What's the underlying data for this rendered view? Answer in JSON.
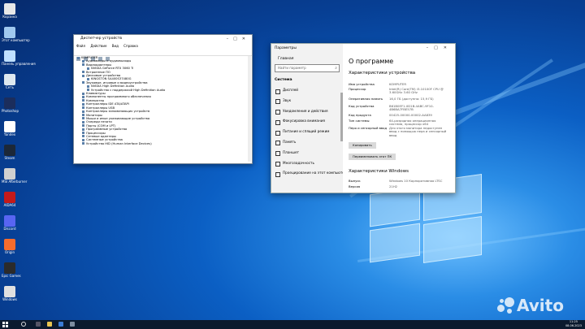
{
  "desktop_icons": [
    {
      "label": "Корзина",
      "color": "#e8e8e8"
    },
    {
      "label": "Этот компьютер",
      "color": "#9fc8ef"
    },
    {
      "label": "Панель управления",
      "color": "#bfe0ff"
    },
    {
      "label": "Сеть",
      "color": "#dde8f0"
    },
    {
      "label": "Photoshop",
      "color": "#1b2d5c"
    },
    {
      "label": "Yandex",
      "color": "#ffffff"
    },
    {
      "label": "Steam",
      "color": "#1c2838"
    },
    {
      "label": "MSI Afterburner",
      "color": "#d0d0d0"
    },
    {
      "label": "AIDA64",
      "color": "#c41a1a"
    },
    {
      "label": "Discord",
      "color": "#5865f2"
    },
    {
      "label": "Origin",
      "color": "#f56c2d"
    },
    {
      "label": "Epic Games",
      "color": "#2b2b2b"
    },
    {
      "label": "Windows",
      "color": "#e0e0e0"
    }
  ],
  "device_manager": {
    "title": "Диспетчер устройств",
    "menu": [
      "Файл",
      "Действие",
      "Вид",
      "Справка"
    ],
    "tree": [
      {
        "label": "KOMPUTER",
        "level": 0
      },
      {
        "label": "Аудиовходы и аудиовыходы",
        "level": 1
      },
      {
        "label": "Видеоадаптеры",
        "level": 1
      },
      {
        "label": "NVIDIA GeForce RTX 3060 Ti",
        "level": 2
      },
      {
        "label": "Встроенное ПО",
        "level": 1
      },
      {
        "label": "Дисковые устройства",
        "level": 1
      },
      {
        "label": "KINGSTON SA400S37480G",
        "level": 2
      },
      {
        "label": "Звуковые, игровые и видеоустройства",
        "level": 1
      },
      {
        "label": "NVIDIA High Definition Audio",
        "level": 2
      },
      {
        "label": "Устройство с поддержкой High Definition Audio",
        "level": 2
      },
      {
        "label": "Клавиатуры",
        "level": 1
      },
      {
        "label": "Компоненты программного обеспечения",
        "level": 1
      },
      {
        "label": "Компьютер",
        "level": 1
      },
      {
        "label": "Контроллеры IDE ATA/ATAPI",
        "level": 1
      },
      {
        "label": "Контроллеры USB",
        "level": 1
      },
      {
        "label": "Контроллеры запоминающих устройств",
        "level": 1
      },
      {
        "label": "Мониторы",
        "level": 1
      },
      {
        "label": "Мыши и иные указывающие устройства",
        "level": 1
      },
      {
        "label": "Очереди печати",
        "level": 1
      },
      {
        "label": "Порты (COM и LPT)",
        "level": 1
      },
      {
        "label": "Программные устройства",
        "level": 1
      },
      {
        "label": "Процессоры",
        "level": 1
      },
      {
        "label": "Сетевые адаптеры",
        "level": 1
      },
      {
        "label": "Системные устройства",
        "level": 1
      },
      {
        "label": "Устройства HID (Human Interface Devices)",
        "level": 1
      }
    ]
  },
  "settings": {
    "window_title": "Параметры",
    "home": "Главная",
    "search_placeholder": "Найти параметр",
    "section": "Система",
    "nav": [
      "Дисплей",
      "Звук",
      "Уведомления и действия",
      "Фокусировка внимания",
      "Питание и спящий режим",
      "Память",
      "Планшет",
      "Многозадачность",
      "Проецирование на этот компьютер"
    ],
    "page_title": "О программе",
    "device_specs_title": "Характеристики устройства",
    "specs": [
      {
        "k": "Имя устройства",
        "v": "KOMPUTER"
      },
      {
        "k": "Процессор",
        "v": "Intel(R) Core(TM) i3-10100F CPU @ 3.60GHz   3.60 GHz"
      },
      {
        "k": "Оперативная память",
        "v": "16,0 ГБ (доступно: 15,9 ГБ)"
      },
      {
        "k": "Код устройства",
        "v": "B61B0EF1-0D1B-4ABC-9F10-4B6BA7FBE57B"
      },
      {
        "k": "Код продукта",
        "v": "00425-00000-00002-AA839"
      },
      {
        "k": "Тип системы",
        "v": "64-разрядная операционная система, процессор x64"
      },
      {
        "k": "Перо и сенсорный ввод",
        "v": "Для этого монитора недоступен ввод с помощью пера и сенсорный ввод"
      }
    ],
    "copy_button": "Копировать",
    "rename_button": "Переименовать этот ПК",
    "windows_specs_title": "Характеристики Windows",
    "win_specs": [
      {
        "k": "Выпуск",
        "v": "Windows 10 Корпоративная LTSC"
      },
      {
        "k": "Версия",
        "v": "21H2"
      }
    ]
  },
  "taskbar": {
    "time": "11:25",
    "date": "08.06.2023"
  },
  "watermark": "Avito"
}
